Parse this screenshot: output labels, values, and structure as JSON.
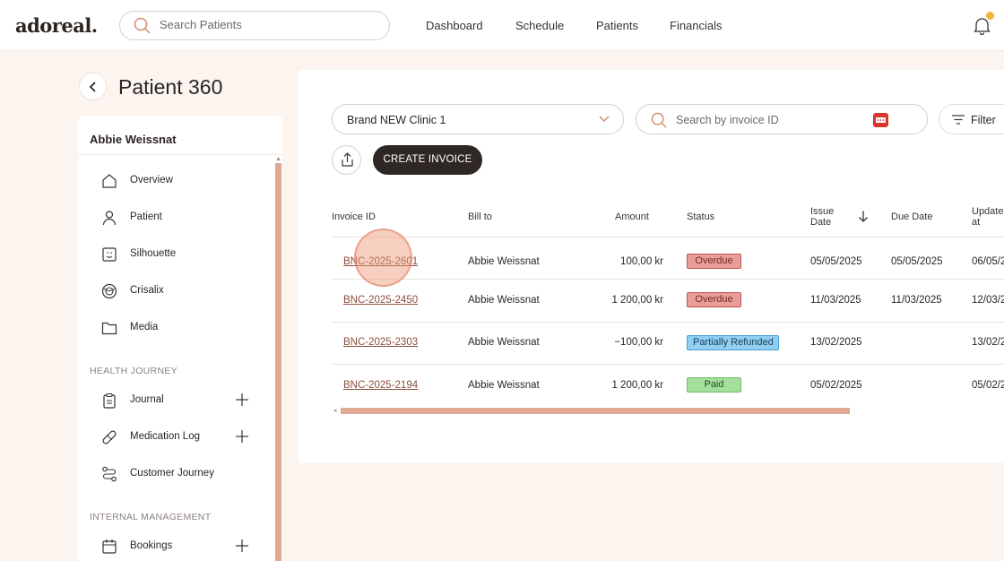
{
  "app": {
    "logo": "adoreal."
  },
  "header": {
    "search_placeholder": "Search Patients",
    "nav": [
      "Dashboard",
      "Schedule",
      "Patients",
      "Financials"
    ],
    "accent_color": "#f4b13c"
  },
  "page": {
    "title": "Patient 360"
  },
  "sidebar": {
    "patient_name": "Abbie Weissnat",
    "items": [
      {
        "label": "Overview",
        "icon": "home-icon"
      },
      {
        "label": "Patient",
        "icon": "person-icon"
      },
      {
        "label": "Silhouette",
        "icon": "silhouette-icon"
      },
      {
        "label": "Crisalix",
        "icon": "crisalix-icon"
      },
      {
        "label": "Media",
        "icon": "folder-icon"
      }
    ],
    "health_section": "HEALTH JOURNEY",
    "health_items": [
      {
        "label": "Journal",
        "icon": "clipboard-icon"
      },
      {
        "label": "Medication Log",
        "icon": "pill-icon"
      },
      {
        "label": "Customer Journey",
        "icon": "route-icon"
      }
    ],
    "internal_section": "INTERNAL MANAGEMENT",
    "internal_items": [
      {
        "label": "Bookings",
        "icon": "calendar-icon"
      }
    ]
  },
  "toolbar": {
    "clinic_value": "Brand NEW Clinic 1",
    "invoice_search_placeholder": "Search by invoice ID",
    "filter_label": "Filter",
    "create_label": "CREATE INVOICE"
  },
  "table": {
    "headers": {
      "invoice_id": "Invoice ID",
      "bill_to": "Bill to",
      "amount": "Amount",
      "status": "Status",
      "issue_date_1": "Issue",
      "issue_date_2": "Date",
      "due_date": "Due Date",
      "updated_1": "Update",
      "updated_2": "at"
    },
    "rows": [
      {
        "invoice_id": "BNC-2025-2601",
        "bill_to": "Abbie Weissnat",
        "amount": "100,00 kr",
        "status": "Overdue",
        "issue_date": "05/05/2025",
        "due_date": "05/05/2025",
        "updated": "06/05/2"
      },
      {
        "invoice_id": "BNC-2025-2450",
        "bill_to": "Abbie Weissnat",
        "amount": "1 200,00 kr",
        "status": "Overdue",
        "issue_date": "11/03/2025",
        "due_date": "11/03/2025",
        "updated": "12/03/2"
      },
      {
        "invoice_id": "BNC-2025-2303",
        "bill_to": "Abbie Weissnat",
        "amount": "−100,00 kr",
        "status": "Partially Refunded",
        "issue_date": "13/02/2025",
        "due_date": "",
        "updated": "13/02/2"
      },
      {
        "invoice_id": "BNC-2025-2194",
        "bill_to": "Abbie Weissnat",
        "amount": "1 200,00 kr",
        "status": "Paid",
        "issue_date": "05/02/2025",
        "due_date": "",
        "updated": "05/02/2"
      }
    ]
  }
}
